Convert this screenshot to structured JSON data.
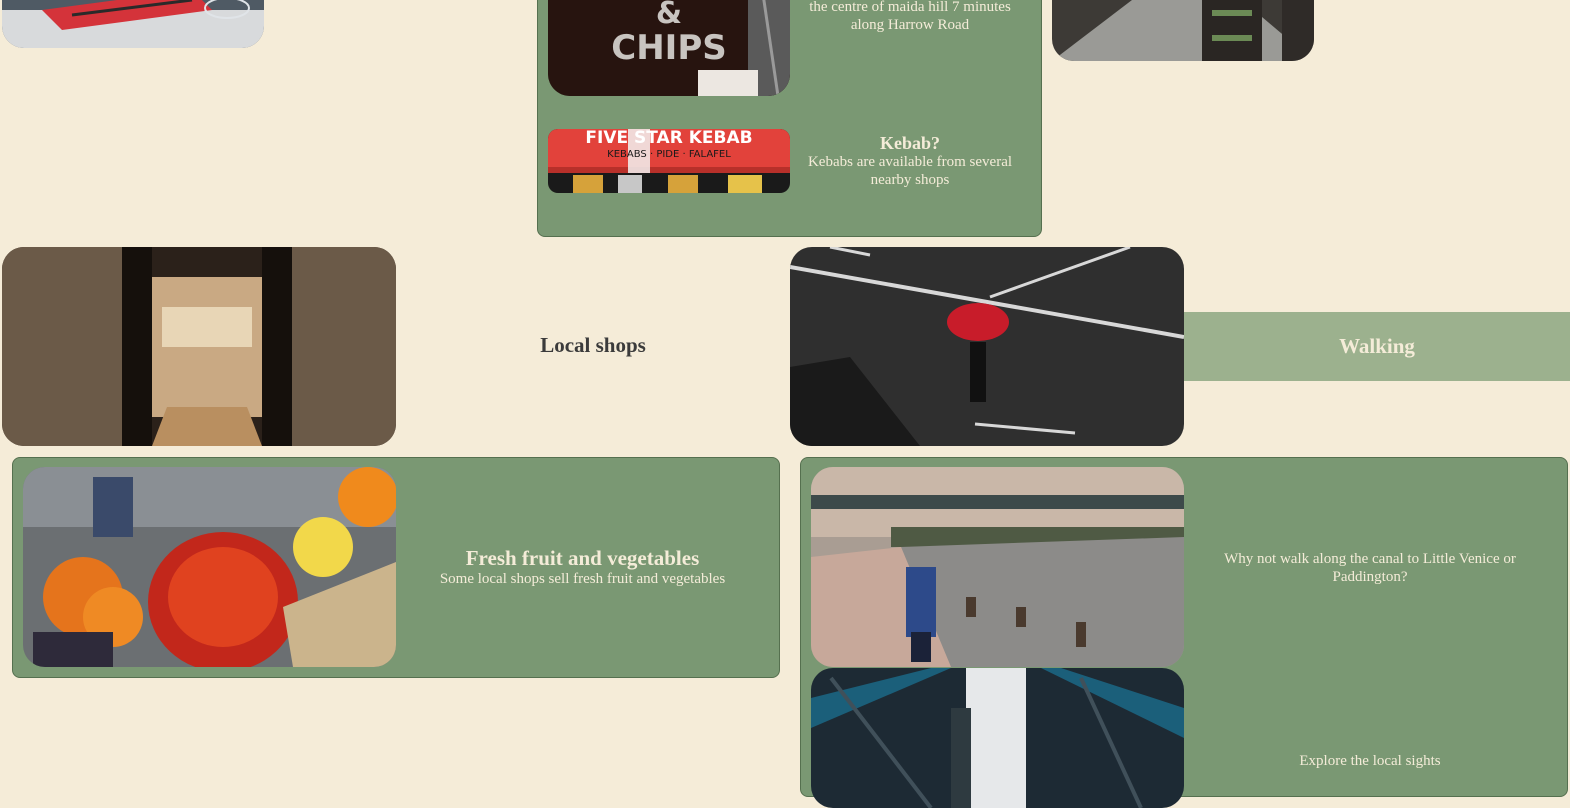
{
  "top": {
    "fishchips": {
      "sign_line1": "&",
      "sign_line2": "CHIPS",
      "desc_line1": "the centre of maida hill 7 minutes",
      "desc_line2": "along Harrow Road"
    },
    "kebab": {
      "sign": "FIVE STAR KEBAB",
      "sign_sub": "KEBABS · PIDE · FALAFEL",
      "title": "Kebab?",
      "desc": "Kebabs are available from several nearby shops"
    }
  },
  "sections": {
    "local_shops": "Local shops",
    "walking": "Walking"
  },
  "fruit": {
    "title": "Fresh fruit and vegetables",
    "desc": "Some local shops sell fresh fruit and vegetables"
  },
  "walk": {
    "canal_desc": "Why not walk along the canal to Little Venice or Paddington?",
    "sights_desc": "Explore the local sights"
  },
  "colors": {
    "background": "#f5ecd8",
    "panel": "#7a9873",
    "accent_bar": "#9cb18e",
    "text_light": "#f4ecd8",
    "heading": "#3b3b3b"
  }
}
